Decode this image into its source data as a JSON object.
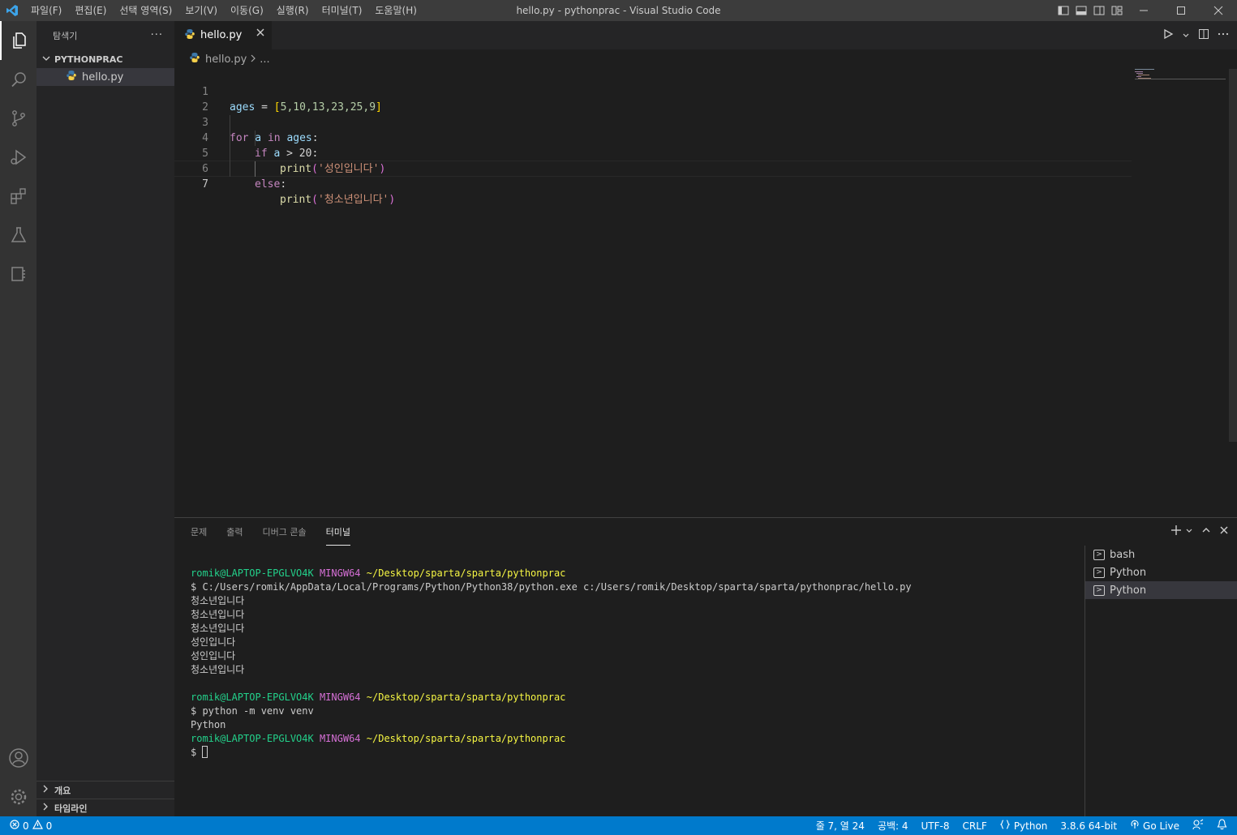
{
  "window": {
    "title": "hello.py - pythonprac - Visual Studio Code",
    "menu": [
      "파일(F)",
      "편집(E)",
      "선택 영역(S)",
      "보기(V)",
      "이동(G)",
      "실행(R)",
      "터미널(T)",
      "도움말(H)"
    ]
  },
  "sidebar": {
    "title": "탐색기",
    "more": "···",
    "folder": "PYTHONPRAC",
    "file": "hello.py",
    "outline": "개요",
    "timeline": "타임라인"
  },
  "editor": {
    "tab_label": "hello.py",
    "breadcrumb_file": "hello.py",
    "breadcrumb_more": "...",
    "line_numbers": [
      "1",
      "2",
      "3",
      "4",
      "5",
      "6",
      "7"
    ],
    "code": {
      "l1": {
        "var": "ages",
        "op": " = ",
        "ob": "[",
        "nums": "5,10,13,23,25,9",
        "cb": "]"
      },
      "l3": {
        "kw1": "for",
        "v1": " a ",
        "kw2": "in",
        "v2": " ages",
        "colon": ":"
      },
      "l4": {
        "kw": "if",
        "v": " a ",
        "rest": "> 20:"
      },
      "l5": {
        "fn": "print",
        "ob": "(",
        "str": "'성인입니다'",
        "cb": ")"
      },
      "l6": {
        "kw": "else",
        "colon": ":"
      },
      "l7": {
        "fn": "print",
        "ob": "(",
        "str": "'청소년입니다'",
        "cb": ")"
      }
    }
  },
  "panel": {
    "tabs": [
      "문제",
      "출력",
      "디버그 콘솔",
      "터미널"
    ],
    "terminal": {
      "user": "romik@LAPTOP-EPGLVO4K",
      "env": "MINGW64",
      "path": "~/Desktop/sparta/sparta/pythonprac",
      "cmd1": "$ C:/Users/romik/AppData/Local/Programs/Python/Python38/python.exe c:/Users/romik/Desktop/sparta/sparta/pythonprac/hello.py",
      "output": [
        "청소년입니다",
        "청소년입니다",
        "청소년입니다",
        "성인입니다",
        "성인입니다",
        "청소년입니다"
      ],
      "cmd2": "$ python -m venv venv",
      "out2": "Python",
      "prompt": "$ "
    },
    "terminal_list": [
      "bash",
      "Python",
      "Python"
    ]
  },
  "statusbar": {
    "errors": "0",
    "warnings": "0",
    "position": "줄 7, 열 24",
    "spaces": "공백: 4",
    "encoding": "UTF-8",
    "eol": "CRLF",
    "language": "Python",
    "interpreter": "3.8.6 64-bit",
    "golive": "Go Live"
  },
  "colors": {
    "accent": "#007acc",
    "editor_bg": "#1e1e1e",
    "sidebar_bg": "#252526",
    "activity_bg": "#333333"
  }
}
